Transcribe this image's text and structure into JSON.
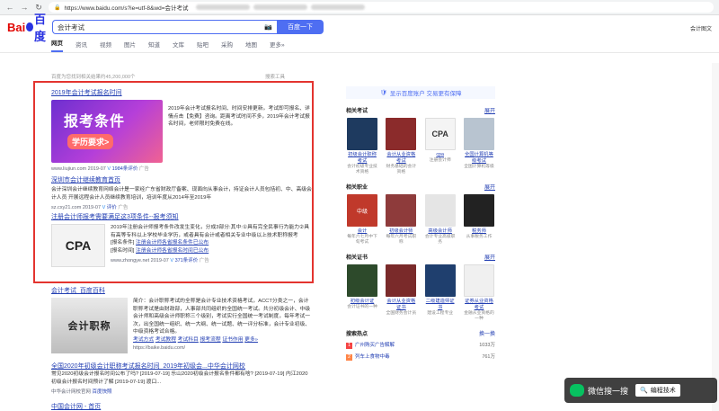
{
  "browser": {
    "url": "https://www.baidu.com/s?ie=utf-8&wd=会计考试"
  },
  "header": {
    "logo_bai": "Bai",
    "logo_du": "百度",
    "query": "会计考试",
    "search_btn": "百度一下",
    "right_link": "会计图文"
  },
  "tabs": [
    "网页",
    "资讯",
    "视频",
    "图片",
    "知道",
    "文库",
    "贴吧",
    "采购",
    "地图",
    "更多»"
  ],
  "result_count": {
    "text": "百度为您找到相关结果约45,200,000个",
    "tool": "搜索工具"
  },
  "results": [
    {
      "title": "2019年会计考试报名时间",
      "poster_big": "报考条件",
      "poster_sub": "学历要求>",
      "body": "2019年会计考试报名时间、时间安排更新。考试即可报名、详情点击【免费】咨询。距离考试时间不多，2019年会计考试报名时间，老师限时免费在线。",
      "url": "www.liujiun.com",
      "date": "2019-07",
      "eval": "1984条评价",
      "ad": "广告"
    },
    {
      "title": "深圳市会计继续教育首页",
      "body": "会计深圳会计继续教育网络会计是一家经广东省财政厅备案、现面向从事会计，持证会计人员包括初、中、高级会计人员 开展远程会计人员继续教育培训，培训年度从2014年至2019年",
      "url": "sz.cxy21.com",
      "date": "2019-07",
      "eval": "评价",
      "ad": "广告"
    },
    {
      "title": "注册会计师报考需要满足这3项条件--报考须知",
      "body": "2019年注册会计师报考条件改发生变化，分成3部分:其中:①具有完全民事行为能力②具有高等专科以上学校毕业学历，或者具有会计或者相关专业中级以上技术职称报考",
      "link1_label": "[报名条件]",
      "link1": "注册会计师各省报名条件已公布",
      "link2_label": "[报名时间]",
      "link2": "注册会计师各省报名时间已公布",
      "url": "www.zhongye.net",
      "date": "2019-07",
      "eval": "371条评价",
      "ad": "广告"
    },
    {
      "title": "会计考试_百度百科",
      "thumb": "会计职称",
      "body": "简介：会计职称考试的全称是会计专业技术资格考试，ACCT分类之一，会计职称考试是由财政部，人事部共同组织的全国统一考试。共分初级会计、中级会计师和高级会计师职称三个级别，考试实行全国统一考试制度，每年考试一次，出全国统一组织、统一大纲、统一试题、统一评分标准，会计专业初级、中级资格考试合格。",
      "links": [
        "考试方式",
        "考试教程",
        "考试科目",
        "报考流程",
        "证书作用",
        "更多»"
      ],
      "url": "https://baike.baidu.com/"
    },
    {
      "title": "全国2020年初级会计职称考试报名时间_2019年初级会...中华会计网校",
      "body": "常见2020初级会计报名时间公布了吗? [2019-07-19] 乐山2020初级会计报名条件都有啥? [2019-07-19] 内江2020初级会计报名时间预计了解 [2019-07-19] 渡口...",
      "url": "中华会计网校官网",
      "snap": "百度快照"
    },
    {
      "title": "中国会计网 - 首页"
    }
  ],
  "right": {
    "promo": "显示百度账户 交易更有保障",
    "sections": [
      {
        "title": "相关考试",
        "more": "展开",
        "items": [
          {
            "name": "初级会计职称考试",
            "desc": "会计初级专业技术资格"
          },
          {
            "name": "会计从业资格考试",
            "desc": "财务基础的会计资格"
          },
          {
            "name": "cpa",
            "desc": "注册会计师"
          },
          {
            "name": "全国计算机等级考试",
            "desc": "全国计算机等级"
          }
        ]
      },
      {
        "title": "相关职业",
        "more": "展开",
        "items": [
          {
            "name": "会计",
            "desc": "每年六七月中下旬考试"
          },
          {
            "name": "初级会计师",
            "desc": "每年六月考试职称"
          },
          {
            "name": "高级会计师",
            "desc": "会计专业高级职务"
          },
          {
            "name": "税务师",
            "desc": "从事税务工作"
          }
        ]
      },
      {
        "title": "相关证书",
        "more": "展开",
        "items": [
          {
            "name": "初级会计证",
            "desc": "会计证书的一种"
          },
          {
            "name": "会计从业资格证书",
            "desc": "全国财务会计员"
          },
          {
            "name": "二级建造师证书",
            "desc": "建设工程专业"
          },
          {
            "name": "证券从业资格考试",
            "desc": "金融从业资格的一种"
          }
        ]
      }
    ],
    "hot": {
      "title": "搜索热点",
      "refresh": "换一换",
      "items": [
        {
          "rank": "1",
          "name": "广州购买广告解解",
          "count": "1033万"
        },
        {
          "rank": "2",
          "name": "列车上食物中毒",
          "count": "761万"
        }
      ]
    }
  },
  "wechat": {
    "label": "微信搜一搜",
    "search": "编程技术"
  }
}
